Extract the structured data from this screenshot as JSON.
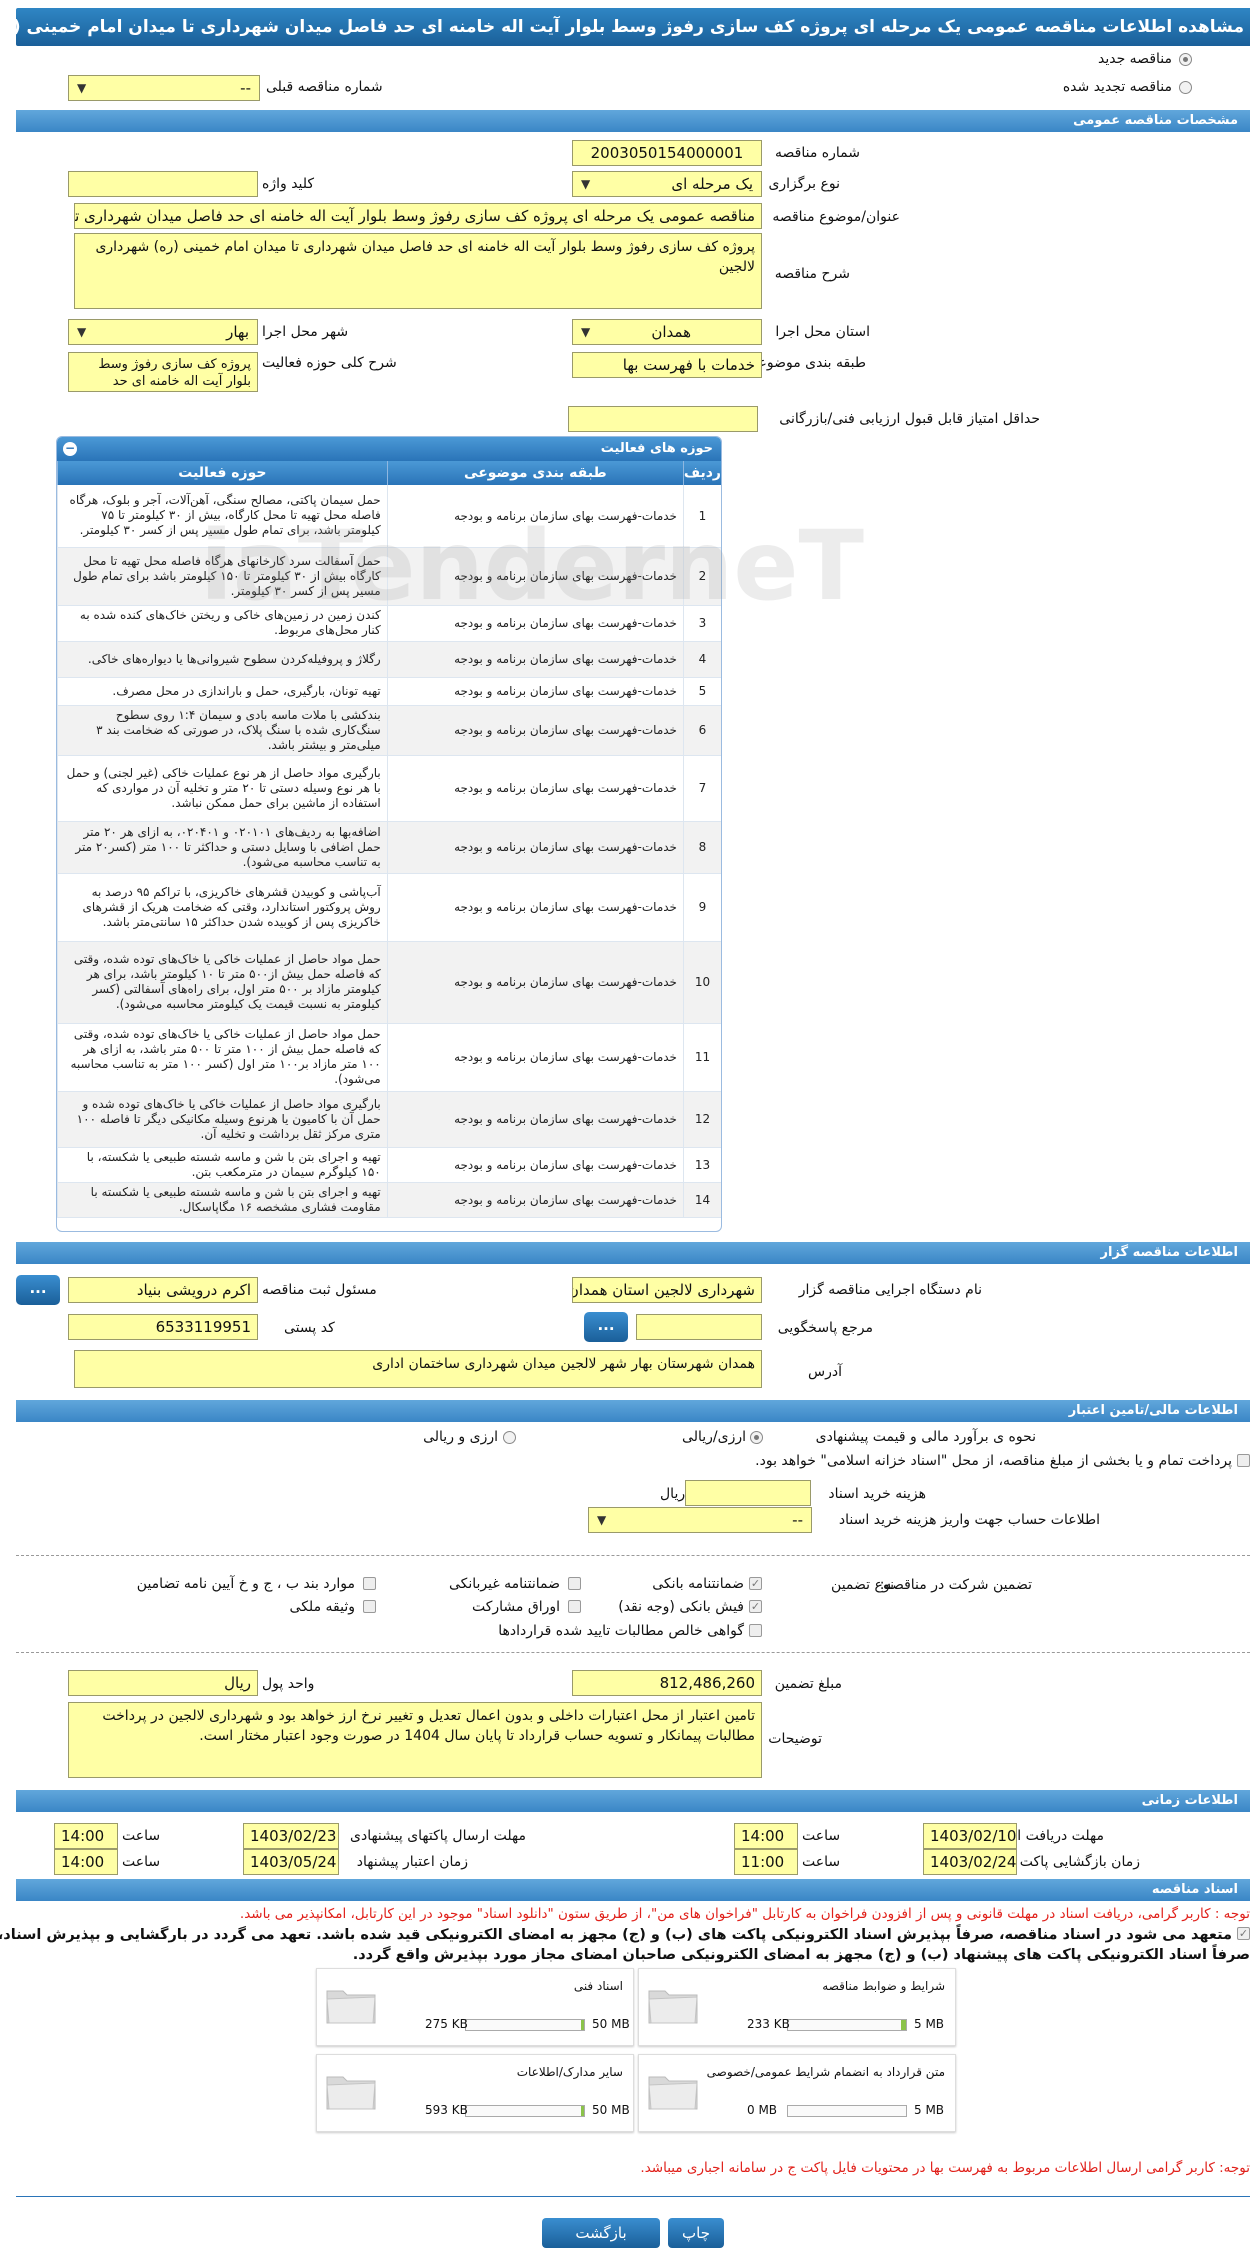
{
  "page_title": "مشاهده اطلاعات مناقصه عمومی یک مرحله ای پروژه کف سازی رفوژ وسط بلوار آیت اله خامنه ای حد فاصل میدان شهرداری تا میدان امام خمینی (ره) شهرداری لالجین",
  "tender_type": {
    "new_label": "مناقصه جدید",
    "renewed_label": "مناقصه تجدید شده",
    "prev_number_label": "شماره مناقصه قبلی",
    "prev_number_value": "--"
  },
  "general": {
    "section_title": "مشخصات مناقصه عمومی",
    "number_label": "شماره مناقصه",
    "number_value": "2003050154000001",
    "hold_type_label": "نوع برگزاری",
    "hold_type_value": "یک مرحله ای",
    "keyword_label": "کلید واژه",
    "keyword_value": "",
    "subject_label": "عنوان/موضوع مناقصه",
    "subject_value": "مناقصه عمومی یک مرحله ای پروژه کف سازی رفوژ وسط بلوار آیت اله خامنه ای حد فاصل میدان شهرداری تا میدان امام خمینی (ره) شهرداری لالجین",
    "description_label": "شرح مناقصه",
    "description_value": "پروژه کف سازی رفوژ وسط بلوار آیت اله خامنه ای حد فاصل میدان شهرداری تا میدان امام خمینی (ره) شهرداری لالجین",
    "province_label": "استان محل اجرا",
    "province_value": "همدان",
    "city_label": "شهر محل اجرا",
    "city_value": "بهار",
    "category_label": "طبقه بندی موضوعی",
    "category_value": "خدمات با فهرست بها",
    "activity_desc_label": "شرح کلی حوزه فعالیت",
    "activity_desc_value": "پروژه کف سازی رفوژ وسط بلوار آیت اله خامنه ای حد",
    "min_score_label": "حداقل امتیاز قابل قبول ارزیابی فنی/بازرگانی",
    "min_score_value": ""
  },
  "activities": {
    "panel_title": "حوزه های فعالیت",
    "col_row": "ردیف",
    "col_category": "طبقه بندی موضوعی",
    "col_activity": "حوزه فعالیت",
    "rows": [
      {
        "n": "1",
        "cat": "خدمات-فهرست بهای سازمان برنامه و بودجه",
        "act": "حمل سیمان پاکتی، مصالح سنگی، آهن‌آلات، آجر و بلوک، هرگاه فاصله محل تهیه تا محل کارگاه، بیش از ۳۰ کیلومتر تا ۷۵ کیلومتر باشد، برای تمام طول مسیر پس از کسر ۳۰ کیلومتر."
      },
      {
        "n": "2",
        "cat": "خدمات-فهرست بهای سازمان برنامه و بودجه",
        "act": "حمل آسفالت سرد کارخانهای هرگاه فاصله محل تهیه تا محل کارگاه بیش از ۳۰ کیلومتر تا ۱۵۰ کیلومتر باشد برای تمام طول مسیر پس از کسر ۳۰ کیلومتر."
      },
      {
        "n": "3",
        "cat": "خدمات-فهرست بهای سازمان برنامه و بودجه",
        "act": "کندن زمین در زمین‌های خاکی و ریختن خاک‌های کنده شده به کنار محل‌های مربوط."
      },
      {
        "n": "4",
        "cat": "خدمات-فهرست بهای سازمان برنامه و بودجه",
        "act": "رگلاژ و پروفیله‌کردن سطوح شیروانی‌ها یا دیواره‌های خاکی."
      },
      {
        "n": "5",
        "cat": "خدمات-فهرست بهای سازمان برنامه و بودجه",
        "act": "تهیه تونان، بارگیری، حمل و باراندازی در محل مصرف."
      },
      {
        "n": "6",
        "cat": "خدمات-فهرست بهای سازمان برنامه و بودجه",
        "act": "بندکشی با ملات ماسه بادی و سیمان ۱:۴ روی سطوح سنگ‌کاری شده با سنگ پلاک، در صورتی که ضخامت بند ۳ میلی‌متر و بیشتر باشد."
      },
      {
        "n": "7",
        "cat": "خدمات-فهرست بهای سازمان برنامه و بودجه",
        "act": "بارگیری مواد حاصل از هر نوع عملیات خاکی (غیر لجنی) و حمل با هر نوع وسیله دستی تا ۲۰ متر و تخلیه آن در مواردی که استفاده از ماشین برای حمل ممکن نباشد."
      },
      {
        "n": "8",
        "cat": "خدمات-فهرست بهای سازمان برنامه و بودجه",
        "act": "اضافه‌بها به ردیف‌های ۰۲۰۱۰۱ و ۰۲۰۴۰۱، به ازای هر ۲۰ متر حمل اضافی با وسایل دستی و حداکثر تا ۱۰۰ متر (کسر۲۰ متر به تناسب محاسبه می‌شود)."
      },
      {
        "n": "9",
        "cat": "خدمات-فهرست بهای سازمان برنامه و بودجه",
        "act": "آب‌پاشی و کوبیدن قشرهای خاکریزی، با تراکم ۹۵ درصد به روش پروکتور استاندارد، وقتی که ضخامت هریک از قشرهای خاکریزی پس از کوبیده شدن حداکثر ۱۵ سانتی‌متر باشد."
      },
      {
        "n": "10",
        "cat": "خدمات-فهرست بهای سازمان برنامه و بودجه",
        "act": "حمل مواد حاصل از عملیات خاکی یا خاک‌های توده شده، وقتی که فاصله حمل بیش از۵۰۰ متر تا ۱۰ کیلومتر باشد، برای هر کیلومتر مازاد بر ۵۰۰ متر اول، برای راه‌های آسفالتی (کسر کیلومتر به نسبت قیمت یک کیلومتر محاسبه می‌شود)."
      },
      {
        "n": "11",
        "cat": "خدمات-فهرست بهای سازمان برنامه و بودجه",
        "act": "حمل مواد حاصل از عملیات خاکی یا خاک‌های توده شده، وقتی که فاصله حمل بیش از ۱۰۰ متر تا ۵۰۰ متر باشد، به ازای هر ۱۰۰ متر مازاد بر۱۰۰ متر اول (کسر ۱۰۰ متر به تناسب محاسبه می‌شود)."
      },
      {
        "n": "12",
        "cat": "خدمات-فهرست بهای سازمان برنامه و بودجه",
        "act": "بارگیری مواد حاصل از عملیات خاکی یا خاک‌های توده شده و حمل آن با کامیون یا هرنوع وسیله مکانیکی دیگر تا فاصله ۱۰۰ متری مرکز ثقل برداشت و تخلیه آن."
      },
      {
        "n": "13",
        "cat": "خدمات-فهرست بهای سازمان برنامه و بودجه",
        "act": "تهیه و اجرای بتن با شن و ماسه شسته طبیعی یا شکسته، با ۱۵۰ کیلوگرم سیمان در مترمکعب بتن."
      },
      {
        "n": "14",
        "cat": "خدمات-فهرست بهای سازمان برنامه و بودجه",
        "act": "تهیه و اجرای بتن با شن و ماسه شسته طبیعی یا شکسته با مقاومت فشاری مشخصه ۱۶ مگاپاسکال."
      }
    ]
  },
  "organizer": {
    "section_title": "اطلاعات مناقصه گزار",
    "org_label": "نام دستگاه اجرایی مناقصه گزار",
    "org_value": "شهرداری لالجین استان همدان",
    "registrar_label": "مسئول ثبت مناقصه",
    "registrar_value": "اکرم درویشی بنیاد",
    "responder_label": "مرجع پاسخگویی",
    "responder_value": "",
    "postal_label": "کد پستی",
    "postal_value": "6533119951",
    "address_label": "آدرس",
    "address_value": "همدان شهرستان بهار شهر لالجین میدان شهرداری ساختمان اداری",
    "dots_label": "..."
  },
  "finance": {
    "section_title": "اطلاعات مالی/تامین اعتبار",
    "estimate_label": "نحوه ی برآورد مالی و قیمت پیشنهادی",
    "opt_rial_label": "ارزی/ریالی",
    "opt_currency_label": "ارزی و ریالی",
    "payment_text": "پرداخت تمام و یا بخشی از مبلغ مناقصه، از محل \"اسناد خزانه اسلامی\" خواهد بود.",
    "doc_cost_label": "هزینه خرید اسناد",
    "doc_cost_value": "",
    "doc_cost_unit": "ریال",
    "account_label": "اطلاعات حساب جهت واریز هزینه خرید اسناد",
    "account_value": "--",
    "guarantee_intro": "تضمین شرکت در مناقصه:",
    "guarantee_type_label": "نوع تضمین",
    "g_bank": "ضمانتنامه بانکی",
    "g_nonbank": "ضمانتنامه غیربانکی",
    "g_items": "موارد بند ب ، ج و خ آیین نامه تضامین",
    "g_cash": "فیش بانکی (وجه نقد)",
    "g_bonds": "اوراق مشارکت",
    "g_property": "وثیقه ملکی",
    "g_claims": "گواهی خالص مطالبات تایید شده قراردادها",
    "amount_label": "مبلغ تضمین",
    "amount_value": "812,486,260",
    "currency_label": "واحد پول",
    "currency_value": "ریال",
    "notes_label": "توضیحات",
    "notes_value": "تامین اعتبار از محل اعتبارات داخلی و بدون اعمال تعدیل و تغییر نرخ ارز خواهد بود و شهرداری لالجین در پرداخت مطالبات پیمانکار و تسویه حساب قرارداد تا پایان سال 1404 در صورت وجود اعتبار مختار است."
  },
  "timing": {
    "section_title": "اطلاعات زمانی",
    "receive_deadline_label": "مهلت دریافت اسناد",
    "receive_deadline_date": "1403/02/10",
    "receive_deadline_time": "14:00",
    "send_deadline_label": "مهلت ارسال پاکتهای پیشنهادی",
    "send_deadline_date": "1403/02/23",
    "send_deadline_time": "14:00",
    "open_label": "زمان بازگشایی پاکت ها",
    "open_date": "1403/02/24",
    "open_time": "11:00",
    "validity_label": "زمان اعتبار پیشنهاد",
    "validity_date": "1403/05/24",
    "validity_time": "14:00",
    "time_label": "ساعت"
  },
  "documents": {
    "section_title": "اسناد مناقصه",
    "note_red": "توجه : کاربر گرامی، دریافت اسناد در مهلت قانونی و پس از افزودن فراخوان به کارتابل \"فراخوان های من\"، از طریق ستون \"دانلود اسناد\" موجود در این کارتابل، امکانپذیر می باشد.",
    "commit_line1": "متعهد می شود در اسناد مناقصه، صرفاً بپذیرش اسناد الکترونیکی پاکت های (ب) و (ج) مجهز به امضای الکترونیکی قید شده باشد. تعهد می گردد در بارگشایی و بپذیرش اسناد،",
    "commit_line2": "صرفاً اسناد الکترونیکی پاکت های پیشنهاد (ب) و (ج) مجهز به امضای الکترونیکی صاحبان امضای مجاز مورد بپذیرش واقع گردد.",
    "items": [
      {
        "name": "شرایط و ضوابط مناقصه",
        "used": "233 KB",
        "max": "5 MB",
        "fill": 0.04
      },
      {
        "name": "اسناد فنی",
        "used": "275 KB",
        "max": "50 MB",
        "fill": 0.01
      },
      {
        "name": "متن قرارداد به انضمام شرایط عمومی/خصوصی",
        "used": "0 MB",
        "max": "5 MB",
        "fill": 0.0
      },
      {
        "name": "سایر مدارک/اطلاعات",
        "used": "593 KB",
        "max": "50 MB",
        "fill": 0.01
      }
    ],
    "note_bottom": "توجه: کاربر گرامی ارسال اطلاعات مربوط به فهرست بها در محتویات فایل پاکت ج در سامانه اجباری میباشد."
  },
  "footer": {
    "print_label": "چاپ",
    "back_label": "بازگشت"
  },
  "watermark": "iaTenderneT"
}
